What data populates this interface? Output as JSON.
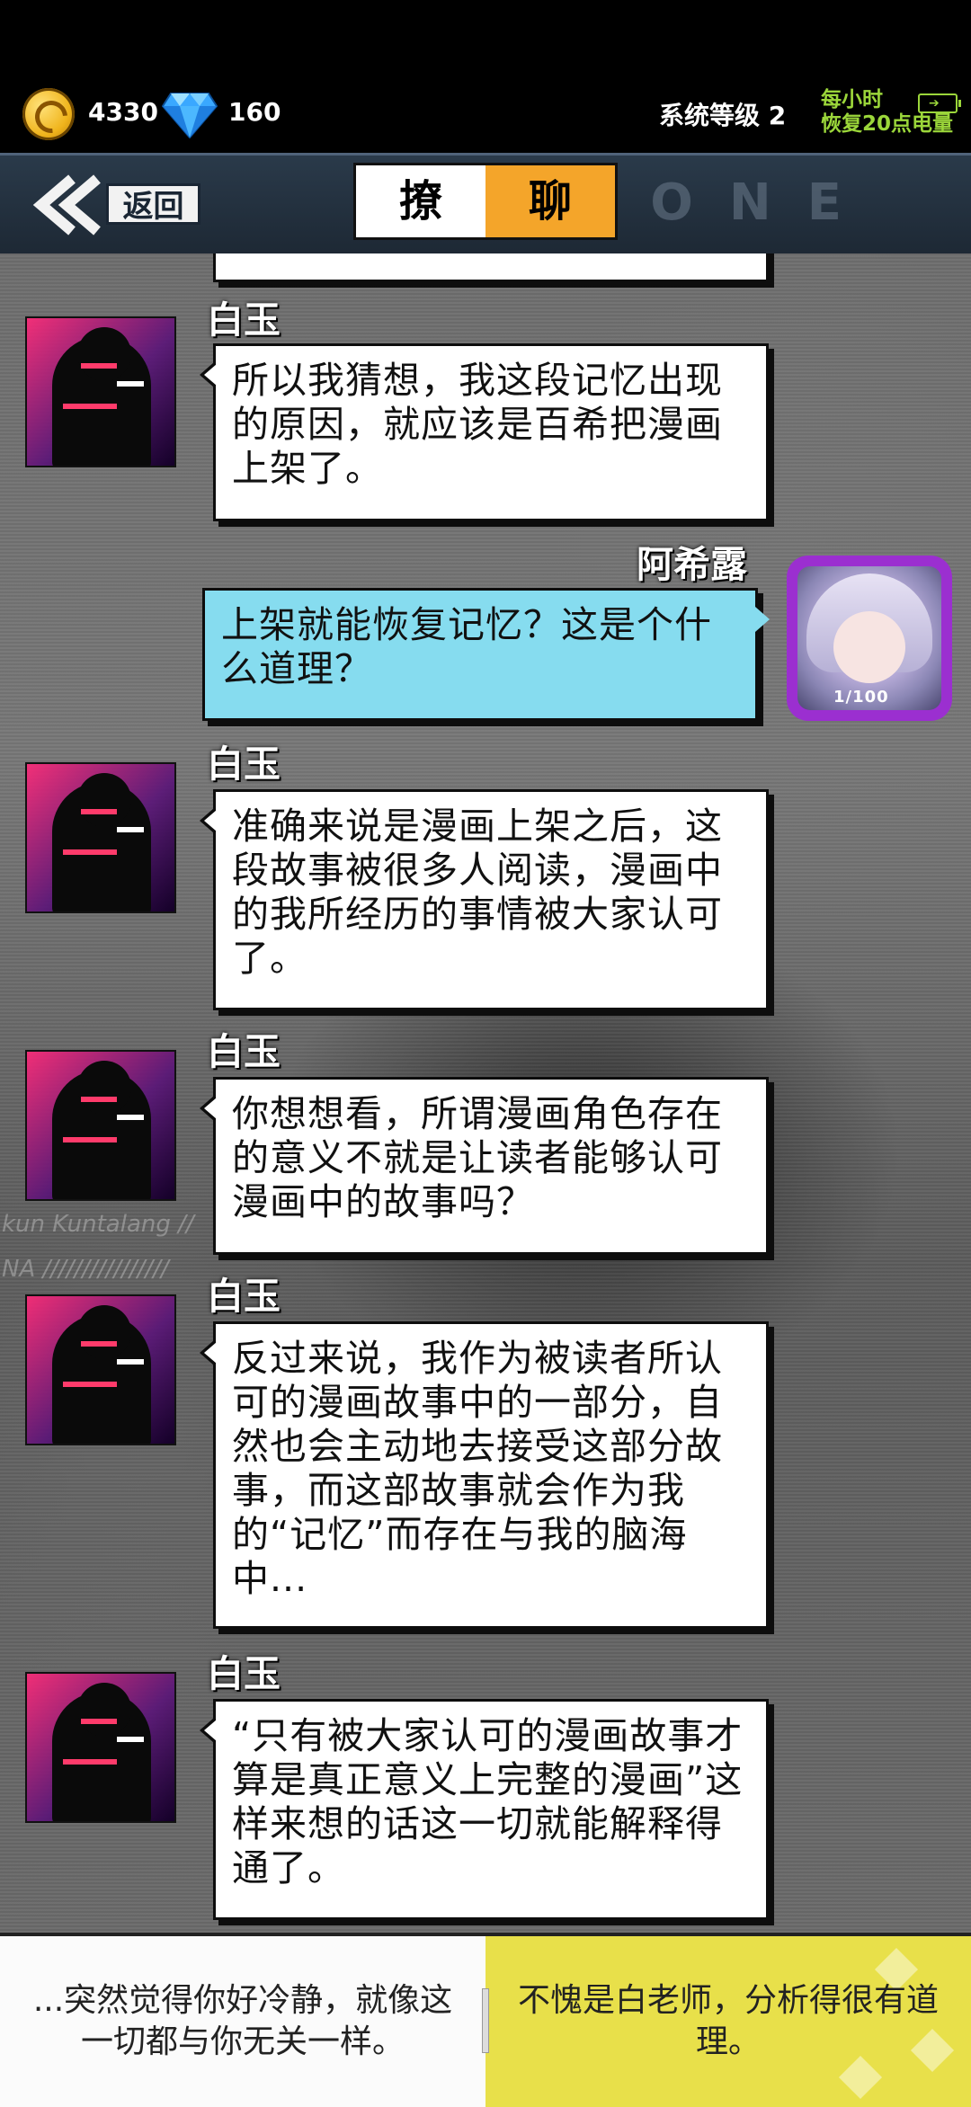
{
  "status": {
    "coins": "4330",
    "gems": "160",
    "system_level": "系统等级 2",
    "energy_line1": "每小时",
    "energy_line2": "恢复20点电量"
  },
  "header": {
    "back_label": "返回",
    "title_left": "撩",
    "title_right": "聊",
    "deco_text": "-ONE"
  },
  "background_text": {
    "line1": "kun Kuntalang //",
    "line2": "NA ////////////////"
  },
  "messages": [
    {
      "sender": "白玉",
      "side": "left",
      "text": "所以我猜想，我这段记忆出现的原因，就应该是百希把漫画上架了。"
    },
    {
      "sender": "阿希露",
      "side": "right",
      "text": "上架就能恢复记忆？这是个什么道理？"
    },
    {
      "sender": "白玉",
      "side": "left",
      "text": "准确来说是漫画上架之后，这段故事被很多人阅读，漫画中的我所经历的事情被大家认可了。"
    },
    {
      "sender": "白玉",
      "side": "left",
      "text": "你想想看，所谓漫画角色存在的意义不就是让读者能够认可漫画中的故事吗？"
    },
    {
      "sender": "白玉",
      "side": "left",
      "text": "反过来说，我作为被读者所认可的漫画故事中的一部分，自然也会主动地去接受这部分故事，而这部故事就会作为我的“记忆”而存在与我的脑海中..."
    },
    {
      "sender": "白玉",
      "side": "left",
      "text": "“只有被大家认可的漫画故事才算是真正意义上完整的漫画”这样来想的话这一切就能解释得通了。"
    }
  ],
  "avatar_tag": "1/100",
  "choices": {
    "option_a": "...突然觉得你好冷静，就像这一切都与你无关一样。",
    "option_b": "不愧是白老师，分析得很有道理。"
  },
  "colors": {
    "choice_b_bg": "#e8e04a",
    "title_accent": "#f4a52a",
    "player_bubble": "#86dcef",
    "energy_text": "#9bd63a"
  }
}
